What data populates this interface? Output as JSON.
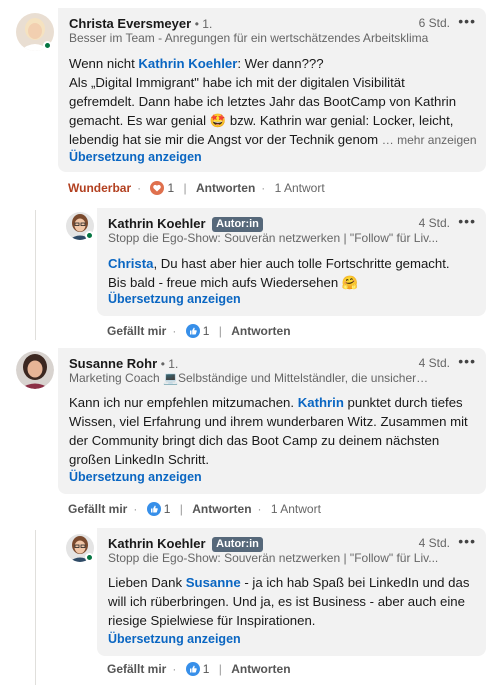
{
  "comments": [
    {
      "author": "Christa Eversmeyer",
      "degree": "• 1.",
      "time": "6 Std.",
      "headline": "Besser im Team - Anregungen für ein wertschätzendes Arbeitsklima",
      "text_intro": "Wenn nicht ",
      "mention": "Kathrin Koehler",
      "text_after_mention": ": Wer dann???",
      "line2": "Als „Digital Immigrant\" habe ich mit der digitalen Visibilität",
      "line3": "gefremdelt. Dann habe ich letztes Jahr das BootCamp von Kathrin",
      "line4a": "gemacht. Es war genial ",
      "emoji1": "🤩",
      "line4b": " bzw. Kathrin war genial: Locker, leicht,",
      "line5": "lebendig hat sie mir die Angst vor der Technik genom",
      "more": "… mehr anzeigen",
      "translate": "Übersetzung anzeigen",
      "reaction_label": "Wunderbar",
      "reaction_count": "1",
      "reply_label": "Antworten",
      "reply_count": "1 Antwort"
    },
    {
      "author": "Kathrin Koehler",
      "author_badge": "Autor:in",
      "time": "4 Std.",
      "headline": "Stopp die Ego-Show: Souverän netzwerken | \"Follow\" für Liv...",
      "mention": "Christa",
      "text1": ", Du hast aber hier auch tolle Fortschritte gemacht.",
      "text2": "Bis bald - freue mich aufs Wiedersehen ",
      "emoji": "🤗",
      "translate": "Übersetzung anzeigen",
      "like_label": "Gefällt mir",
      "like_count": "1",
      "reply_label": "Antworten"
    },
    {
      "author": "Susanne Rohr",
      "degree": "• 1.",
      "time": "4 Std.",
      "headline": "Marketing Coach 💻Selbständige und Mittelständler, die unsicher si...",
      "text1": "Kann ich nur empfehlen mitzumachen. ",
      "mention": "Kathrin",
      "text1b": " punktet durch tiefes",
      "text2": "Wissen, viel Erfahrung und ihrem wunderbaren Witz. Zusammen mit",
      "text3": "der Community bringt dich das Boot Camp zu deinem nächsten",
      "text4": "großen LinkedIn Schritt.",
      "translate": "Übersetzung anzeigen",
      "like_label": "Gefällt mir",
      "like_count": "1",
      "reply_label": "Antworten",
      "reply_count": "1 Antwort"
    },
    {
      "author": "Kathrin Koehler",
      "author_badge": "Autor:in",
      "time": "4 Std.",
      "headline": "Stopp die Ego-Show: Souverän netzwerken | \"Follow\" für Liv...",
      "text1a": "Lieben Dank ",
      "mention": "Susanne",
      "text1b": " - ja ich hab Spaß bei LinkedIn und das",
      "text2": "will ich rüberbringen. Und ja, es ist Business - aber auch eine",
      "text3": "riesige Spielwiese für Inspirationen.",
      "translate": "Übersetzung anzeigen",
      "like_label": "Gefällt mir",
      "like_count": "1",
      "reply_label": "Antworten"
    }
  ],
  "colors": {
    "link": "#0a66c2",
    "bubble": "#f2f2f2",
    "online": "#057642",
    "badge": "#56687a",
    "wunderbar": "#b24020"
  }
}
